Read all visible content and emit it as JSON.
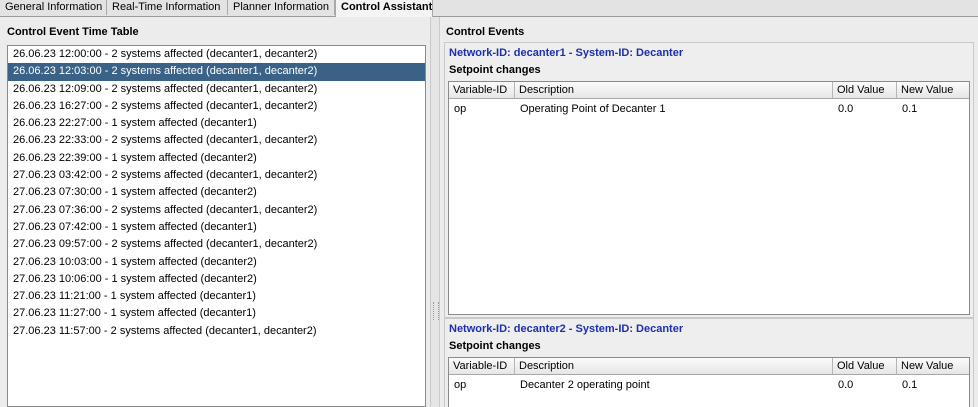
{
  "tabs": [
    {
      "label": "General Information"
    },
    {
      "label": "Real-Time Information"
    },
    {
      "label": "Planner Information"
    },
    {
      "label": "Control Assistant"
    }
  ],
  "left": {
    "title": "Control Event Time Table",
    "selected_index": 1,
    "events": [
      "26.06.23 12:00:00 - 2 systems affected (decanter1, decanter2)",
      "26.06.23 12:03:00 - 2 systems affected (decanter1, decanter2)",
      "26.06.23 12:09:00 - 2 systems affected (decanter1, decanter2)",
      "26.06.23 16:27:00 - 2 systems affected (decanter1, decanter2)",
      "26.06.23 22:27:00 - 1 system affected (decanter1)",
      "26.06.23 22:33:00 - 2 systems affected (decanter1, decanter2)",
      "26.06.23 22:39:00 - 1 system affected (decanter2)",
      "27.06.23 03:42:00 - 2 systems affected (decanter1, decanter2)",
      "27.06.23 07:30:00 - 1 system affected (decanter2)",
      "27.06.23 07:36:00 - 2 systems affected (decanter1, decanter2)",
      "27.06.23 07:42:00 - 1 system affected (decanter1)",
      "27.06.23 09:57:00 - 2 systems affected (decanter1, decanter2)",
      "27.06.23 10:03:00 - 1 system affected (decanter2)",
      "27.06.23 10:06:00 - 1 system affected (decanter2)",
      "27.06.23 11:21:00 - 1 system affected (decanter1)",
      "27.06.23 11:27:00 - 1 system affected (decanter1)",
      "27.06.23 11:57:00 - 2 systems affected (decanter1, decanter2)"
    ]
  },
  "right": {
    "title": "Control Events",
    "sections": [
      {
        "network_title": "Network-ID: decanter1 - System-ID: Decanter",
        "subtitle": "Setpoint changes",
        "columns": [
          "Variable-ID",
          "Description",
          "Old Value",
          "New Value"
        ],
        "rows": [
          {
            "variable": "op",
            "description": "Operating Point of Decanter 1",
            "old": "0.0",
            "new": "0.1"
          }
        ]
      },
      {
        "network_title": "Network-ID: decanter2 - System-ID: Decanter",
        "subtitle": "Setpoint changes",
        "columns": [
          "Variable-ID",
          "Description",
          "Old Value",
          "New Value"
        ],
        "rows": [
          {
            "variable": "op",
            "description": "Decanter 2 operating point",
            "old": "0.0",
            "new": "0.1"
          }
        ]
      }
    ]
  },
  "colors": {
    "selection": "#3a6287",
    "network_title": "#1d2fb0"
  }
}
